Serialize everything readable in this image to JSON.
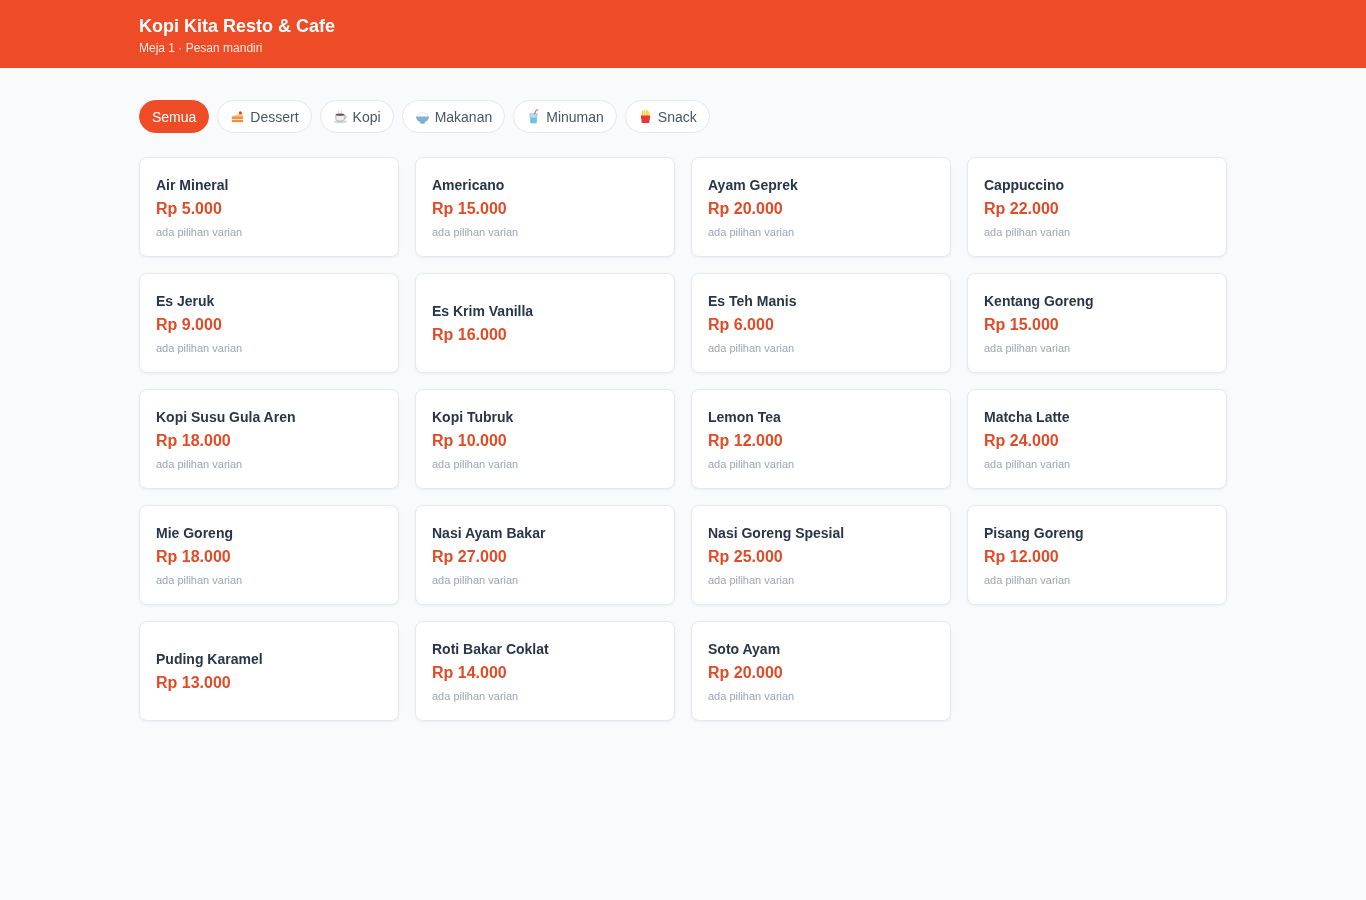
{
  "header": {
    "title": "Kopi Kita Resto & Cafe",
    "subtitle": "Meja 1 · Pesan mandiri"
  },
  "tabs": [
    {
      "label": "Semua",
      "selected": true
    },
    {
      "label": "Dessert",
      "selected": false
    },
    {
      "label": "Kopi",
      "selected": false
    },
    {
      "label": "Makanan",
      "selected": false
    },
    {
      "label": "Minuman",
      "selected": false
    },
    {
      "label": "Snack",
      "selected": false
    }
  ],
  "menu_items": [
    {
      "name": "Air Mineral",
      "price": "Rp 5.000",
      "note": "ada pilihan varian"
    },
    {
      "name": "Americano",
      "price": "Rp 15.000",
      "note": "ada pilihan varian"
    },
    {
      "name": "Ayam Geprek",
      "price": "Rp 20.000",
      "note": "ada pilihan varian"
    },
    {
      "name": "Cappuccino",
      "price": "Rp 22.000",
      "note": "ada pilihan varian"
    },
    {
      "name": "Es Jeruk",
      "price": "Rp 9.000",
      "note": "ada pilihan varian"
    },
    {
      "name": "Es Krim Vanilla",
      "price": "Rp 16.000"
    },
    {
      "name": "Es Teh Manis",
      "price": "Rp 6.000",
      "note": "ada pilihan varian"
    },
    {
      "name": "Kentang Goreng",
      "price": "Rp 15.000",
      "note": "ada pilihan varian"
    },
    {
      "name": "Kopi Susu Gula Aren",
      "price": "Rp 18.000",
      "note": "ada pilihan varian"
    },
    {
      "name": "Kopi Tubruk",
      "price": "Rp 10.000",
      "note": "ada pilihan varian"
    },
    {
      "name": "Lemon Tea",
      "price": "Rp 12.000",
      "note": "ada pilihan varian"
    },
    {
      "name": "Matcha Latte",
      "price": "Rp 24.000",
      "note": "ada pilihan varian"
    },
    {
      "name": "Mie Goreng",
      "price": "Rp 18.000",
      "note": "ada pilihan varian"
    },
    {
      "name": "Nasi Ayam Bakar",
      "price": "Rp 27.000",
      "note": "ada pilihan varian"
    },
    {
      "name": "Nasi Goreng Spesial",
      "price": "Rp 25.000",
      "note": "ada pilihan varian"
    },
    {
      "name": "Pisang Goreng",
      "price": "Rp 12.000",
      "note": "ada pilihan varian"
    },
    {
      "name": "Puding Karamel",
      "price": "Rp 13.000"
    },
    {
      "name": "Roti Bakar Coklat",
      "price": "Rp 14.000",
      "note": "ada pilihan varian"
    },
    {
      "name": "Soto Ayam",
      "price": "Rp 20.000",
      "note": "ada pilihan varian"
    }
  ]
}
